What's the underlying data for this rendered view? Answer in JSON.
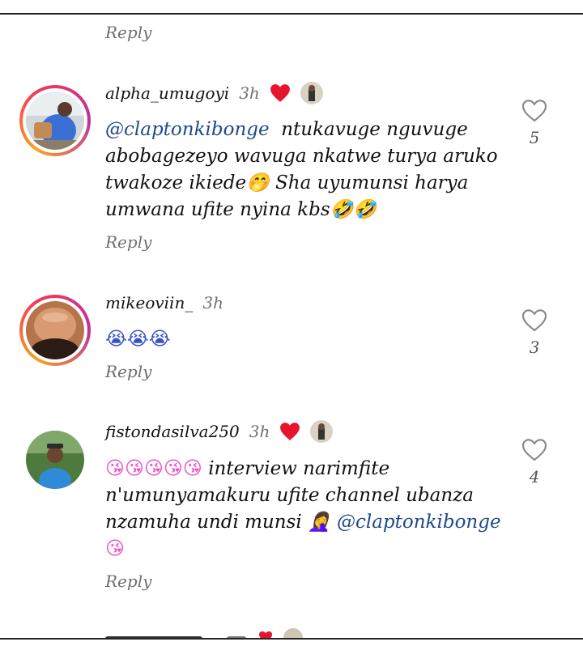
{
  "reply_label": "Reply",
  "comments": [
    {
      "username": "alpha_umugoyi",
      "time": "3h",
      "mention": "@claptonkibonge",
      "text": "ntukavuge nguvuge abobagezeyo wavuga nkatwe turya aruko twakoze ikiede🤭 Sha uyumunsi harya umwana ufite nyina kbs🤣🤣",
      "likes": "5"
    },
    {
      "username": "mikeoviin_",
      "time": "3h",
      "text": "😭😭😭",
      "likes": "3"
    },
    {
      "username": "fistondasilva250",
      "time": "3h",
      "text_lead": "😘😘😘😘😘",
      "text": "interview narimfite n'umunyamakuru ufite channel ubanza nzamuha undi munsi 🤦‍♀️",
      "mention": "@claptonkibonge",
      "text_tail": "😘",
      "likes": "4"
    }
  ],
  "colors": {
    "mention": "#1e4a8a",
    "heart_red": "#e8132c",
    "reply_gray": "#6f6f6f"
  },
  "icons": [
    "heart-outline-icon",
    "heart-filled-icon"
  ]
}
